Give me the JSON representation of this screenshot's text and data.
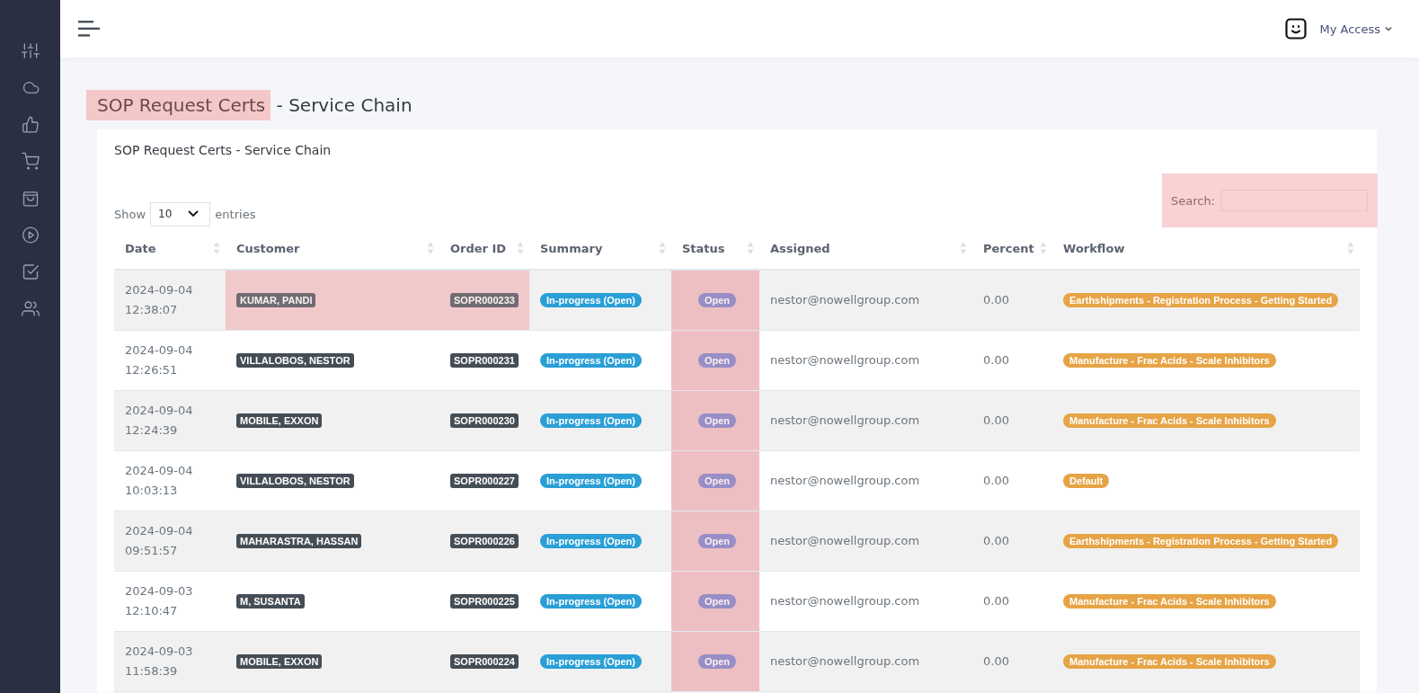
{
  "header": {
    "user_menu": "My Access"
  },
  "page_title": {
    "parts": [
      {
        "text": "SOP Request Certs",
        "highlighted": true
      },
      {
        "text": " - Service Chain",
        "highlighted": false
      }
    ]
  },
  "card": {
    "title": "SOP Request Certs - Service Chain",
    "length_menu": {
      "before": "Show",
      "value": "10",
      "after": "entries"
    },
    "search": {
      "label": "Search:",
      "highlighted": true
    },
    "table": {
      "columns": [
        {
          "label": "Date",
          "highlighted": false
        },
        {
          "label": "Customer",
          "highlighted": false
        },
        {
          "label": "Order ID",
          "highlighted": false
        },
        {
          "label": "Summary",
          "highlighted": false
        },
        {
          "label": "Status",
          "highlighted": true
        },
        {
          "label": "Assigned",
          "highlighted": false
        },
        {
          "label": "Percent",
          "highlighted": false
        },
        {
          "label": "Workflow",
          "highlighted": false
        }
      ],
      "rows": [
        {
          "date": "2024-09-04",
          "time": "12:38:07",
          "customer": "KUMAR, PANDI",
          "order_id": "SOPR000233",
          "summary": "In-progress (Open)",
          "status": "Open",
          "assigned": "nestor@nowellgroup.com",
          "percent": "0.00",
          "workflow": "Earthshipments - Registration Process - Getting Started",
          "highlighted": true
        },
        {
          "date": "2024-09-04",
          "time": "12:26:51",
          "customer": "VILLALOBOS, NESTOR",
          "order_id": "SOPR000231",
          "summary": "In-progress (Open)",
          "status": "Open",
          "assigned": "nestor@nowellgroup.com",
          "percent": "0.00",
          "workflow": "Manufacture - Frac Acids - Scale Inhibitors",
          "highlighted": false
        },
        {
          "date": "2024-09-04",
          "time": "12:24:39",
          "customer": "MOBILE, EXXON",
          "order_id": "SOPR000230",
          "summary": "In-progress (Open)",
          "status": "Open",
          "assigned": "nestor@nowellgroup.com",
          "percent": "0.00",
          "workflow": "Manufacture - Frac Acids - Scale Inhibitors",
          "highlighted": false
        },
        {
          "date": "2024-09-04",
          "time": "10:03:13",
          "customer": "VILLALOBOS, NESTOR",
          "order_id": "SOPR000227",
          "summary": "In-progress (Open)",
          "status": "Open",
          "assigned": "nestor@nowellgroup.com",
          "percent": "0.00",
          "workflow": "Default",
          "highlighted": false
        },
        {
          "date": "2024-09-04",
          "time": "09:51:57",
          "customer": "MAHARASTRA, HASSAN",
          "order_id": "SOPR000226",
          "summary": "In-progress (Open)",
          "status": "Open",
          "assigned": "nestor@nowellgroup.com",
          "percent": "0.00",
          "workflow": "Earthshipments - Registration Process - Getting Started",
          "highlighted": false
        },
        {
          "date": "2024-09-03",
          "time": "12:10:47",
          "customer": "M, SUSANTA",
          "order_id": "SOPR000225",
          "summary": "In-progress (Open)",
          "status": "Open",
          "assigned": "nestor@nowellgroup.com",
          "percent": "0.00",
          "workflow": "Manufacture - Frac Acids - Scale Inhibitors",
          "highlighted": false
        },
        {
          "date": "2024-09-03",
          "time": "11:58:39",
          "customer": "MOBILE, EXXON",
          "order_id": "SOPR000224",
          "summary": "In-progress (Open)",
          "status": "Open",
          "assigned": "nestor@nowellgroup.com",
          "percent": "0.00",
          "workflow": "Manufacture - Frac Acids - Scale Inhibitors",
          "highlighted": false
        }
      ]
    }
  }
}
